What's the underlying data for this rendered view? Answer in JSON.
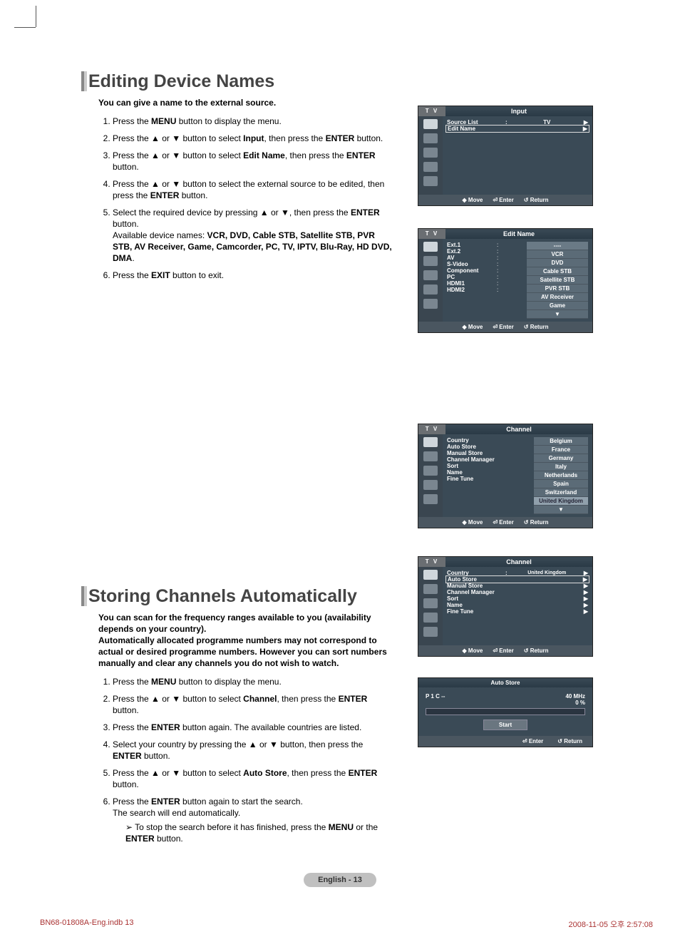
{
  "section1": {
    "title": "Editing Device Names",
    "intro": "You can give a name to the external source.",
    "steps": [
      {
        "pre": "Press the ",
        "b1": "MENU",
        "post": " button to display the menu."
      },
      {
        "pre": "Press the ▲ or ▼ button to select ",
        "b1": "Input",
        "mid": ", then press the ",
        "b2": "ENTER",
        "post": " button."
      },
      {
        "pre": "Press the ▲ or ▼ button to select ",
        "b1": "Edit Name",
        "mid": ", then press the ",
        "b2": "ENTER",
        "post": " button."
      },
      {
        "pre": "Press the ▲ or ▼ button to select the external source to be edited, then press the ",
        "b1": "ENTER",
        "post": " button."
      },
      {
        "pre": "Select the required device by pressing ▲ or ▼, then press the ",
        "b1": "ENTER",
        "post": " button.",
        "extra_pre": "Available device names: ",
        "extra_list": "VCR, DVD, Cable STB, Satellite STB, PVR STB, AV Receiver, Game, Camcorder, PC, TV, IPTV, Blu-Ray, HD DVD, DMA",
        "extra_post": "."
      },
      {
        "pre": "Press the ",
        "b1": "EXIT",
        "post": " button to exit."
      }
    ]
  },
  "section2": {
    "title": "Storing Channels Automatically",
    "intro": "You can scan for the frequency ranges available to you (availability depends on your country).\nAutomatically allocated programme numbers may not correspond to actual or desired programme numbers. However you can sort numbers manually and clear any channels you do not wish to watch.",
    "steps": [
      {
        "pre": "Press the ",
        "b1": "MENU",
        "post": " button to display the menu."
      },
      {
        "pre": "Press the ▲ or ▼ button to select ",
        "b1": "Channel",
        "mid": ", then press the ",
        "b2": "ENTER",
        "post": " button."
      },
      {
        "pre": "Press the ",
        "b1": "ENTER",
        "post": " button again. The available countries are listed."
      },
      {
        "pre": "Select your country by pressing the ▲ or ▼ button, then press the ",
        "b1": "ENTER",
        "post": " button."
      },
      {
        "pre": "Press the ▲ or ▼ button to select ",
        "b1": "Auto Store",
        "mid": ", then press the ",
        "b2": "ENTER",
        "post": " button."
      },
      {
        "pre": "Press the ",
        "b1": "ENTER",
        "post": " button again to start the search.",
        "line2": "The search will end automatically.",
        "sub_pre": "To stop the search before it has finished, press the ",
        "sub_b1": "MENU",
        "sub_mid": " or the ",
        "sub_b2": "ENTER",
        "sub_post": " button."
      }
    ]
  },
  "osd": {
    "tv": "T V",
    "footer": {
      "move": "Move",
      "enter": "Enter",
      "return": "Return"
    },
    "panel1": {
      "title": "Input",
      "rows": [
        {
          "lbl": "Source List",
          "val": "TV",
          "arr": "▶"
        },
        {
          "lbl": "Edit Name",
          "val": "",
          "arr": "▶",
          "boxed": true
        }
      ]
    },
    "panel2": {
      "title": "Edit Name",
      "sources": [
        "Ext.1",
        "Ext.2",
        "AV",
        "S-Video",
        "Component",
        "PC",
        "HDMI1",
        "HDMI2"
      ],
      "options": [
        "----",
        "VCR",
        "DVD",
        "Cable STB",
        "Satellite STB",
        "PVR STB",
        "AV Receiver",
        "Game"
      ],
      "more": "▼"
    },
    "panel3": {
      "title": "Channel",
      "rows": [
        "Country",
        "Auto Store",
        "Manual Store",
        "Channel Manager",
        "Sort",
        "Name",
        "Fine Tune"
      ],
      "options": [
        "Belgium",
        "France",
        "Germany",
        "Italy",
        "Netherlands",
        "Spain",
        "Switzerland",
        "United Kingdom"
      ],
      "more": "▼"
    },
    "panel4": {
      "title": "Channel",
      "rows": [
        {
          "lbl": "Country",
          "val": "United Kingdom",
          "arr": "▶"
        },
        {
          "lbl": "Auto Store",
          "val": "",
          "arr": "▶",
          "boxed": true
        },
        {
          "lbl": "Manual Store",
          "val": "",
          "arr": "▶"
        },
        {
          "lbl": "Channel Manager",
          "val": "",
          "arr": "▶"
        },
        {
          "lbl": "Sort",
          "val": "",
          "arr": "▶"
        },
        {
          "lbl": "Name",
          "val": "",
          "arr": "▶"
        },
        {
          "lbl": "Fine Tune",
          "val": "",
          "arr": "▶"
        }
      ]
    },
    "panel5": {
      "title": "Auto Store",
      "left": "P   1    C   --",
      "right_freq": "40 MHz",
      "right_pct": "0 %",
      "start": "Start"
    }
  },
  "footer": {
    "page": "English - 13"
  },
  "meta": {
    "file": "BN68-01808A-Eng.indb   13",
    "ts": "2008-11-05   오후 2:57:08"
  }
}
